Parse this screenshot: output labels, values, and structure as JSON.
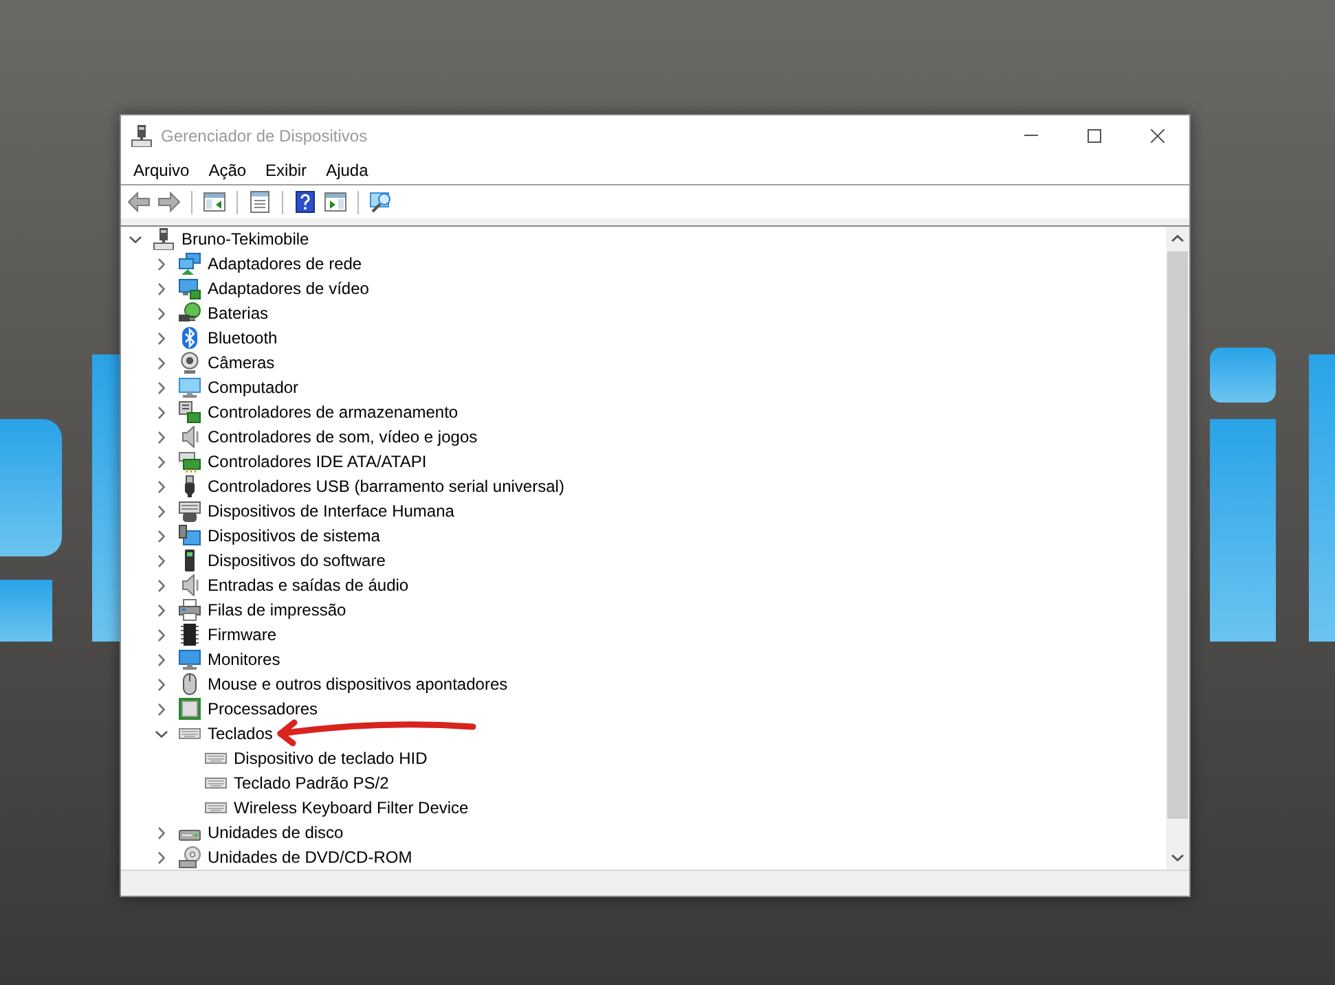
{
  "window": {
    "title": "Gerenciador de Dispositivos"
  },
  "menu": [
    "Arquivo",
    "Ação",
    "Exibir",
    "Ajuda"
  ],
  "toolbar": [
    [
      {
        "kind": "back",
        "disabled": true
      },
      {
        "kind": "forward",
        "disabled": true
      }
    ],
    [
      {
        "kind": "console-tree",
        "disabled": false
      }
    ],
    [
      {
        "kind": "properties",
        "disabled": false
      }
    ],
    [
      {
        "kind": "help",
        "disabled": false
      },
      {
        "kind": "action-pane",
        "disabled": false
      }
    ],
    [
      {
        "kind": "scan",
        "disabled": false
      }
    ]
  ],
  "tree": {
    "label": "Bruno-Tekimobile",
    "kind": "computer-root",
    "expanded": true,
    "children": [
      {
        "label": "Adaptadores de rede",
        "kind": "network",
        "expanded": false
      },
      {
        "label": "Adaptadores de vídeo",
        "kind": "display",
        "expanded": false
      },
      {
        "label": "Baterias",
        "kind": "battery",
        "expanded": false
      },
      {
        "label": "Bluetooth",
        "kind": "bluetooth",
        "expanded": false
      },
      {
        "label": "Câmeras",
        "kind": "camera",
        "expanded": false
      },
      {
        "label": "Computador",
        "kind": "computer",
        "expanded": false
      },
      {
        "label": "Controladores de armazenamento",
        "kind": "storage",
        "expanded": false
      },
      {
        "label": "Controladores de som, vídeo e jogos",
        "kind": "sound",
        "expanded": false
      },
      {
        "label": "Controladores IDE ATA/ATAPI",
        "kind": "ide",
        "expanded": false
      },
      {
        "label": "Controladores USB (barramento serial universal)",
        "kind": "usb",
        "expanded": false
      },
      {
        "label": "Dispositivos de Interface Humana",
        "kind": "hid",
        "expanded": false
      },
      {
        "label": "Dispositivos de sistema",
        "kind": "system",
        "expanded": false
      },
      {
        "label": "Dispositivos do software",
        "kind": "software",
        "expanded": false
      },
      {
        "label": "Entradas e saídas de áudio",
        "kind": "audio-io",
        "expanded": false
      },
      {
        "label": "Filas de impressão",
        "kind": "printer",
        "expanded": false
      },
      {
        "label": "Firmware",
        "kind": "firmware",
        "expanded": false
      },
      {
        "label": "Monitores",
        "kind": "monitor",
        "expanded": false
      },
      {
        "label": "Mouse e outros dispositivos apontadores",
        "kind": "mouse",
        "expanded": false
      },
      {
        "label": "Processadores",
        "kind": "processor",
        "expanded": false
      },
      {
        "label": "Teclados",
        "kind": "keyboard",
        "expanded": true,
        "children": [
          {
            "label": "Dispositivo de teclado HID",
            "kind": "keyboard"
          },
          {
            "label": "Teclado Padrão PS/2",
            "kind": "keyboard"
          },
          {
            "label": "Wireless Keyboard Filter Device",
            "kind": "keyboard"
          }
        ]
      },
      {
        "label": "Unidades de disco",
        "kind": "disk",
        "expanded": false
      },
      {
        "label": "Unidades de DVD/CD-ROM",
        "kind": "dvd",
        "expanded": false
      }
    ]
  }
}
